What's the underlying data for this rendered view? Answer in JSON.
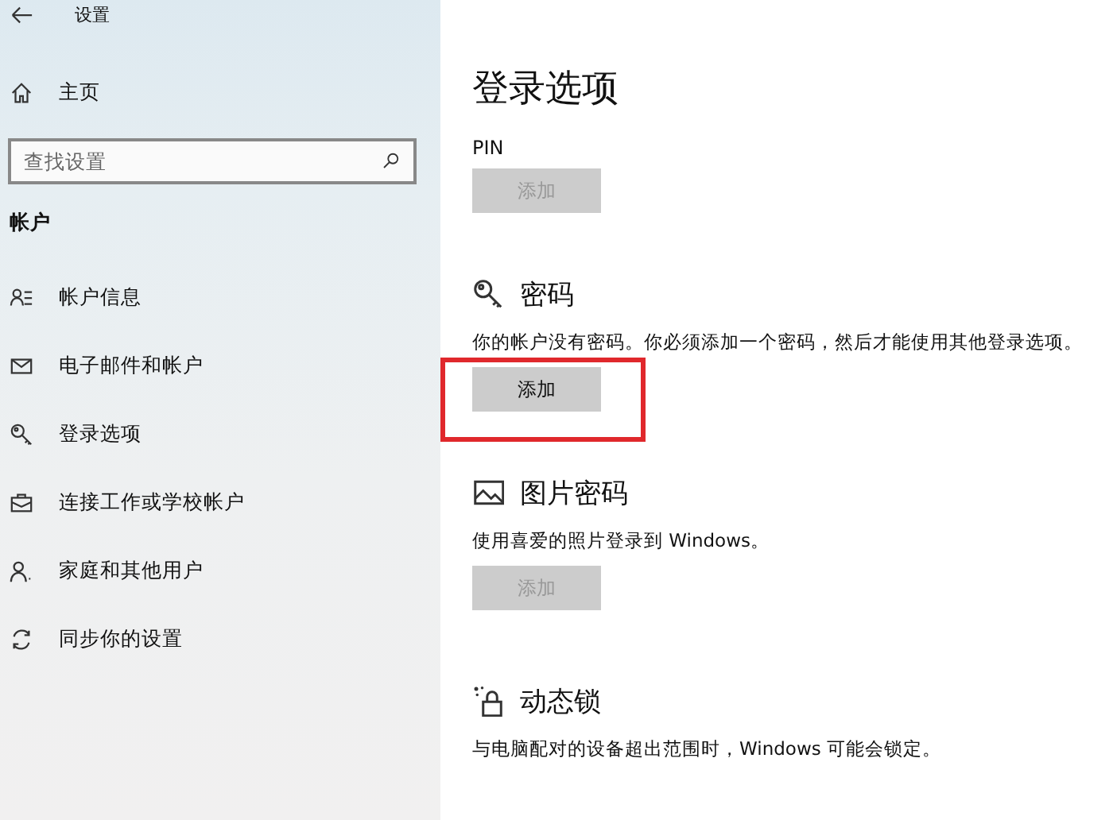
{
  "window": {
    "title": "设置"
  },
  "sidebar": {
    "home": "主页",
    "search": {
      "placeholder": "查找设置"
    },
    "group": "帐户",
    "items": [
      {
        "kind": "info",
        "label": "帐户信息"
      },
      {
        "kind": "mail",
        "label": "电子邮件和帐户"
      },
      {
        "kind": "key",
        "label": "登录选项"
      },
      {
        "kind": "work",
        "label": "连接工作或学校帐户"
      },
      {
        "kind": "family",
        "label": "家庭和其他用户"
      },
      {
        "kind": "sync",
        "label": "同步你的设置"
      }
    ]
  },
  "page": {
    "title": "登录选项",
    "sections": [
      {
        "kind": "pin",
        "heading": "PIN",
        "button": {
          "label": "添加",
          "disabled": true,
          "highlighted": false
        }
      },
      {
        "kind": "password",
        "heading": "密码",
        "description": "你的帐户没有密码。你必须添加一个密码，然后才能使用其他登录选项。",
        "button": {
          "label": "添加",
          "disabled": false,
          "highlighted": true
        }
      },
      {
        "kind": "picture_password",
        "heading": "图片密码",
        "description": "使用喜爱的照片登录到 Windows。",
        "button": {
          "label": "添加",
          "disabled": true,
          "highlighted": false
        }
      },
      {
        "kind": "dynamic_lock",
        "heading": "动态锁",
        "description": "与电脑配对的设备超出范围时，Windows 可能会锁定。"
      }
    ]
  }
}
